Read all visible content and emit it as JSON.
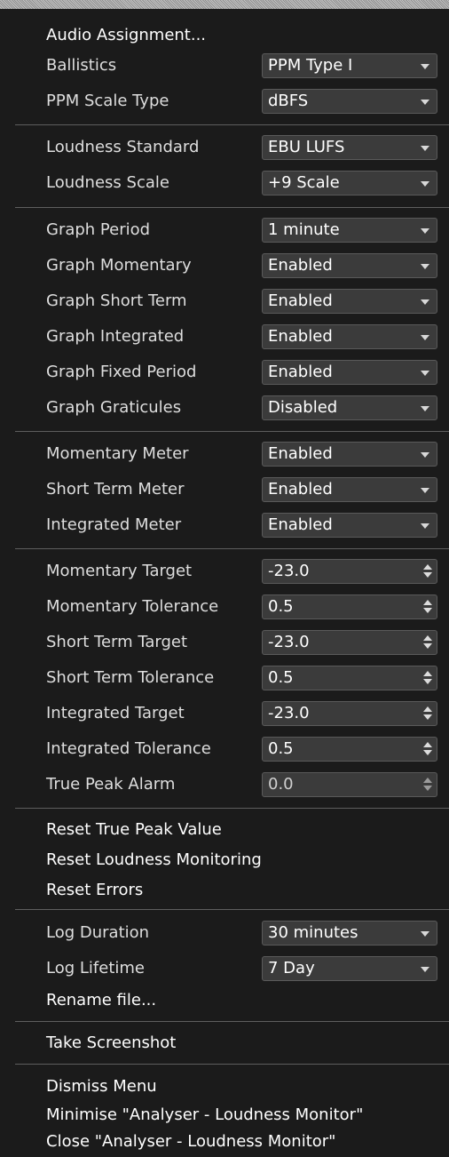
{
  "menu": {
    "audio_assignment": "Audio Assignment...",
    "ballistics": {
      "label": "Ballistics",
      "value": "PPM Type I"
    },
    "ppm_scale_type": {
      "label": "PPM Scale Type",
      "value": "dBFS"
    },
    "loudness_standard": {
      "label": "Loudness Standard",
      "value": "EBU LUFS"
    },
    "loudness_scale": {
      "label": "Loudness Scale",
      "value": "+9 Scale"
    },
    "graph_period": {
      "label": "Graph Period",
      "value": "1 minute"
    },
    "graph_momentary": {
      "label": "Graph Momentary",
      "value": "Enabled"
    },
    "graph_short_term": {
      "label": "Graph Short Term",
      "value": "Enabled"
    },
    "graph_integrated": {
      "label": "Graph Integrated",
      "value": "Enabled"
    },
    "graph_fixed_period": {
      "label": "Graph Fixed Period",
      "value": "Enabled"
    },
    "graph_graticules": {
      "label": "Graph Graticules",
      "value": "Disabled"
    },
    "momentary_meter": {
      "label": "Momentary Meter",
      "value": "Enabled"
    },
    "short_term_meter": {
      "label": "Short Term Meter",
      "value": "Enabled"
    },
    "integrated_meter": {
      "label": "Integrated Meter",
      "value": "Enabled"
    },
    "momentary_target": {
      "label": "Momentary Target",
      "value": "-23.0"
    },
    "momentary_tolerance": {
      "label": "Momentary Tolerance",
      "value": "0.5"
    },
    "short_term_target": {
      "label": "Short Term Target",
      "value": "-23.0"
    },
    "short_term_tolerance": {
      "label": "Short Term Tolerance",
      "value": "0.5"
    },
    "integrated_target": {
      "label": "Integrated Target",
      "value": "-23.0"
    },
    "integrated_tolerance": {
      "label": "Integrated Tolerance",
      "value": "0.5"
    },
    "true_peak_alarm": {
      "label": "True Peak Alarm",
      "value": "0.0"
    },
    "reset_true_peak": "Reset True Peak Value",
    "reset_loudness": "Reset Loudness Monitoring",
    "reset_errors": "Reset Errors",
    "log_duration": {
      "label": "Log Duration",
      "value": "30 minutes"
    },
    "log_lifetime": {
      "label": "Log Lifetime",
      "value": "7 Day"
    },
    "rename_file": "Rename file...",
    "take_screenshot": "Take Screenshot",
    "dismiss_menu": "Dismiss Menu",
    "minimise": "Minimise \"Analyser - Loudness Monitor\"",
    "close": "Close \"Analyser - Loudness Monitor\""
  }
}
